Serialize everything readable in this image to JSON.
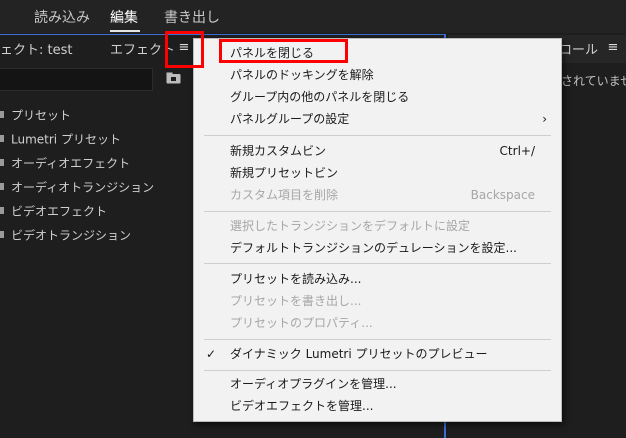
{
  "top_tabs": [
    {
      "label": "読み込み"
    },
    {
      "label": "編集"
    },
    {
      "label": "書き出し"
    }
  ],
  "left_panel": {
    "title": "ェクト: test",
    "tab_label": "エフェクト",
    "menu_icon": "hamburger-icon",
    "search": {
      "value": "",
      "placeholder": ""
    },
    "tree_items": [
      {
        "label": "プリセット"
      },
      {
        "label": "Lumetri プリセット"
      },
      {
        "label": "オーディオエフェクト"
      },
      {
        "label": "オーディオトランジション"
      },
      {
        "label": "ビデオエフェクト"
      },
      {
        "label": "ビデオトランジション"
      }
    ]
  },
  "right_panel": {
    "title": "ロール",
    "status": "されていませ"
  },
  "context_menu": {
    "groups": [
      [
        {
          "label": "パネルを閉じる",
          "enabled": true
        },
        {
          "label": "パネルのドッキングを解除",
          "enabled": true
        },
        {
          "label": "グループ内の他のパネルを閉じる",
          "enabled": true
        },
        {
          "label": "パネルグループの設定",
          "enabled": true,
          "submenu": true
        }
      ],
      [
        {
          "label": "新規カスタムビン",
          "shortcut": "Ctrl+/",
          "enabled": true
        },
        {
          "label": "新規プリセットビン",
          "enabled": true
        },
        {
          "label": "カスタム項目を削除",
          "shortcut": "Backspace",
          "enabled": false
        }
      ],
      [
        {
          "label": "選択したトランジションをデフォルトに設定",
          "enabled": false
        },
        {
          "label": "デフォルトトランジションのデュレーションを設定...",
          "enabled": true
        }
      ],
      [
        {
          "label": "プリセットを読み込み...",
          "enabled": true
        },
        {
          "label": "プリセットを書き出し...",
          "enabled": false
        },
        {
          "label": "プリセットのプロパティ...",
          "enabled": false
        }
      ],
      [
        {
          "label": "ダイナミック Lumetri プリセットのプレビュー",
          "enabled": true,
          "checked": true
        }
      ],
      [
        {
          "label": "オーディオプラグインを管理...",
          "enabled": true
        },
        {
          "label": "ビデオエフェクトを管理...",
          "enabled": true
        }
      ]
    ],
    "check_glyph": "✓",
    "submenu_glyph": "›"
  },
  "highlight_color": "#ff0000",
  "accent_color": "#3b6fd6"
}
